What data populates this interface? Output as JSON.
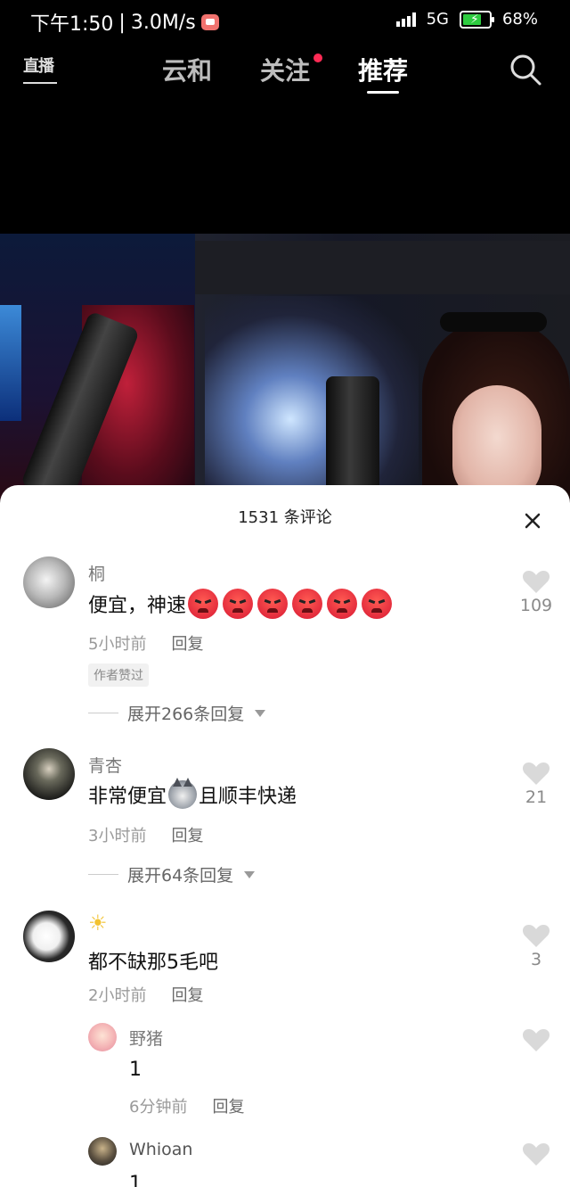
{
  "status_bar": {
    "time": "下午1:50",
    "speed": "3.0M/s",
    "network": "5G",
    "battery": "68%",
    "battery_level": 0.68
  },
  "top_nav": {
    "live_label": "直播",
    "tabs": [
      {
        "label": "云和",
        "active": false
      },
      {
        "label": "关注",
        "active": false,
        "has_dot": true
      },
      {
        "label": "推荐",
        "active": true
      }
    ],
    "search_icon": "search-icon"
  },
  "comments_panel": {
    "title": "1531 条评论",
    "close_icon": "close-icon",
    "comments": [
      {
        "user": "桐",
        "text": "便宜，神速",
        "emoji": "angry-face-emoji",
        "emoji_count": 6,
        "time": "5小时前",
        "reply_label": "回复",
        "author_liked": "作者赞过",
        "likes": "109",
        "expand": "展开266条回复"
      },
      {
        "user": "青杏",
        "text_before": "非常便宜",
        "emoji": "husky-emoji",
        "text_after": "且顺丰快递",
        "time": "3小时前",
        "reply_label": "回复",
        "likes": "21",
        "expand": "展开64条回复"
      },
      {
        "user": "☀",
        "text": "都不缺那5毛吧",
        "time": "2小时前",
        "reply_label": "回复",
        "likes": "3",
        "replies": [
          {
            "user": "野猪",
            "text": "1",
            "time": "6分钟前",
            "reply_label": "回复"
          },
          {
            "user": "Whioan",
            "text": "1"
          }
        ]
      }
    ]
  },
  "colors": {
    "notification_dot": "#ff2b55",
    "heart": "#d9d9d9",
    "battery_fill": "#2ecc40"
  }
}
